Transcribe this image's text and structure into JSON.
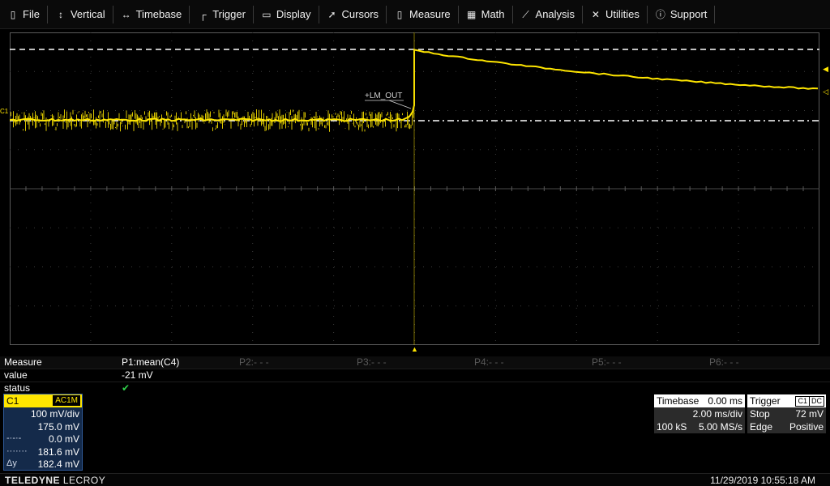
{
  "menu": {
    "file": "File",
    "vertical": "Vertical",
    "timebase": "Timebase",
    "trigger": "Trigger",
    "display": "Display",
    "cursors": "Cursors",
    "measure": "Measure",
    "math": "Math",
    "analysis": "Analysis",
    "utilities": "Utilities",
    "support": "Support"
  },
  "grid": {
    "channel_marker": "C1",
    "trace_annotation": "+LM_OUT"
  },
  "measure": {
    "header": {
      "label": "Measure",
      "p1": "P1:mean(C4)",
      "p2": "P2:- - -",
      "p3": "P3:- - -",
      "p4": "P4:- - -",
      "p5": "P5:- - -",
      "p6": "P6:- - -"
    },
    "value_label": "value",
    "value_p1": "-21 mV",
    "status_label": "status",
    "status_p1": "✔"
  },
  "channel": {
    "name": "C1",
    "coupling": "AC1M",
    "scale": "100 mV/div",
    "offset": "175.0 mV",
    "cursor1_value": "0.0 mV",
    "cursor2_value": "181.6 mV",
    "delta_label": "Δy",
    "delta_value": "182.4 mV"
  },
  "timebase": {
    "title": "Timebase",
    "delay": "0.00 ms",
    "scale": "2.00 ms/div",
    "samples": "100 kS",
    "rate": "5.00 MS/s"
  },
  "trigger": {
    "title": "Trigger",
    "source": "C1",
    "coupling": "DC",
    "mode": "Stop",
    "level": "72 mV",
    "type": "Edge",
    "slope": "Positive"
  },
  "footer": {
    "brand_bold": "TELEDYNE",
    "brand_rest": " LECROY",
    "datetime": "11/29/2019 10:55:18 AM"
  },
  "colors": {
    "trace": "#ffe600",
    "channel_panel": "#142a4a",
    "status_ok": "#2fd14a"
  },
  "icons": {
    "file": "file-icon",
    "vertical": "vertical-arrows-icon",
    "timebase": "horizontal-arrows-icon",
    "trigger": "trigger-icon",
    "display": "display-icon",
    "cursors": "cursor-icon",
    "measure": "measure-icon",
    "math": "calculator-icon",
    "analysis": "analysis-icon",
    "utilities": "tools-icon",
    "support": "info-icon"
  }
}
